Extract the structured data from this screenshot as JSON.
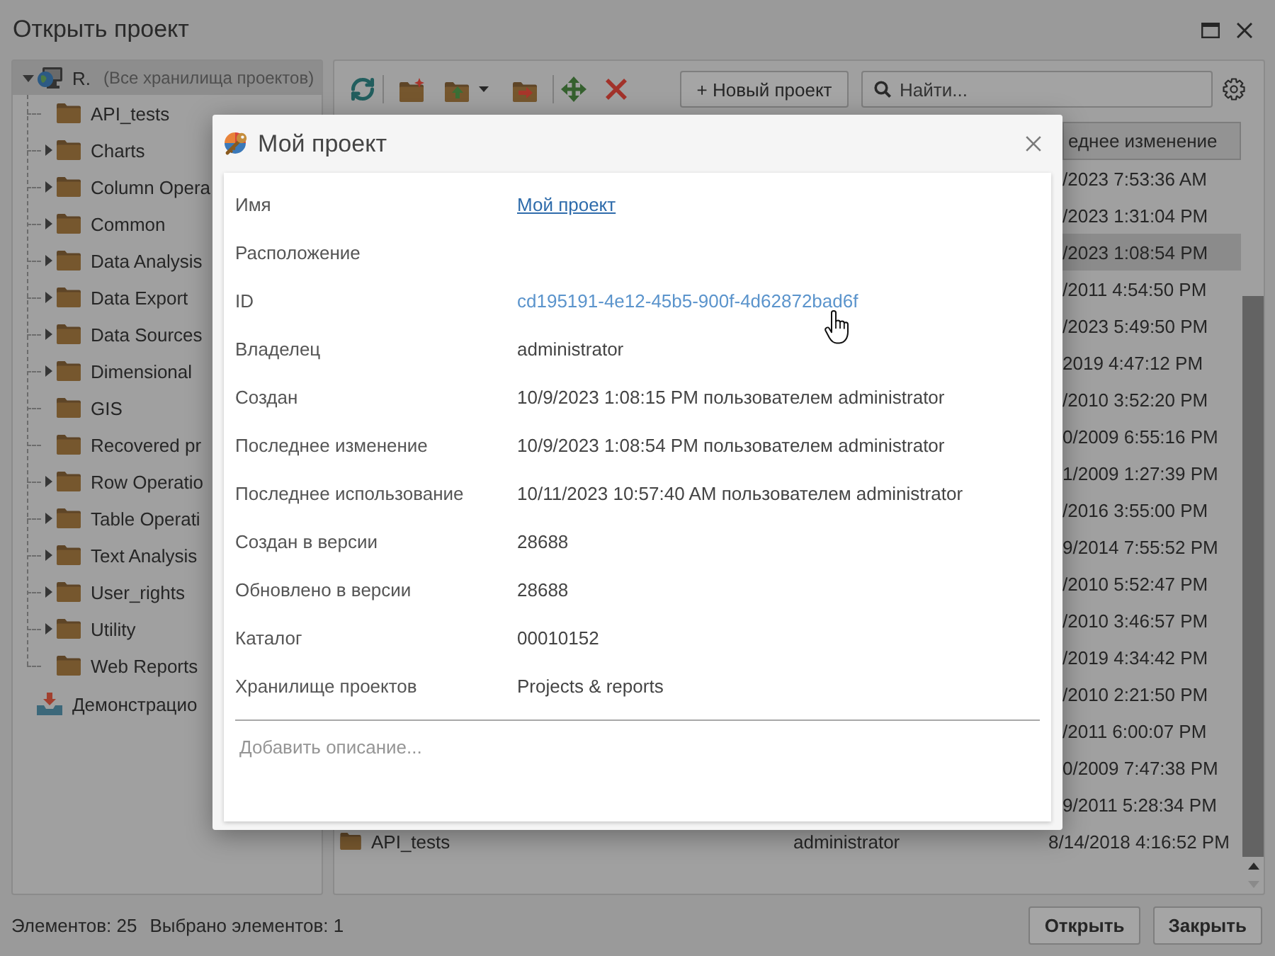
{
  "window": {
    "title": "Открыть проект"
  },
  "tree": [
    {
      "label": "R.",
      "note": "(Все хранилища проектов)",
      "kind": "repositories",
      "expanded": true,
      "selected": true,
      "children": [
        {
          "label": "API_tests",
          "kind": "folder",
          "selected": false
        },
        {
          "label": "Charts",
          "kind": "folder",
          "expanded": false,
          "selected": false
        },
        {
          "label": "Column Opera",
          "kind": "folder",
          "expanded": false,
          "selected": false
        },
        {
          "label": "Common",
          "kind": "folder",
          "expanded": false,
          "selected": false
        },
        {
          "label": "Data Analysis",
          "kind": "folder",
          "expanded": false,
          "selected": false
        },
        {
          "label": "Data Export",
          "kind": "folder",
          "expanded": false,
          "selected": false
        },
        {
          "label": "Data Sources",
          "kind": "folder",
          "expanded": false,
          "selected": false
        },
        {
          "label": "Dimensional",
          "kind": "folder",
          "expanded": false,
          "selected": false
        },
        {
          "label": "GIS",
          "kind": "folder",
          "selected": false
        },
        {
          "label": "Recovered pr",
          "kind": "folder",
          "selected": false
        },
        {
          "label": "Row Operatio",
          "kind": "folder",
          "expanded": false,
          "selected": false
        },
        {
          "label": "Table Operati",
          "kind": "folder",
          "expanded": false,
          "selected": false
        },
        {
          "label": "Text Analysis",
          "kind": "folder",
          "expanded": false,
          "selected": false
        },
        {
          "label": "User_rights",
          "kind": "folder",
          "expanded": false,
          "selected": false
        },
        {
          "label": "Utility",
          "kind": "folder",
          "expanded": false,
          "selected": false
        },
        {
          "label": "Web Reports",
          "kind": "folder",
          "selected": false
        }
      ]
    },
    {
      "label": "Демонстрацио",
      "kind": "demo",
      "selected": false
    }
  ],
  "toolbar": {
    "new_project_button": "+ Новый проект",
    "search": {
      "placeholder": "Найти..."
    }
  },
  "table": {
    "column_3_header": "еднее изменение",
    "rows": [
      {
        "column_3": "/2023 7:53:36 AM",
        "selected": false
      },
      {
        "column_3": "/2023 1:31:04 PM",
        "selected": false
      },
      {
        "column_3": "/2023 1:08:54 PM",
        "selected": true
      },
      {
        "column_3": "/2011 4:54:50 PM",
        "selected": false
      },
      {
        "column_3": "/2023 5:49:50 PM",
        "selected": false
      },
      {
        "column_3": "2019 4:47:12 PM",
        "selected": false
      },
      {
        "column_3": "/2010 3:52:20 PM",
        "selected": false
      },
      {
        "column_3": "0/2009 6:55:16 PM",
        "selected": false
      },
      {
        "column_3": "1/2009 1:27:39 PM",
        "selected": false
      },
      {
        "column_3": "/2016 3:55:00 PM",
        "selected": false
      },
      {
        "column_3": "9/2014 7:55:52 PM",
        "selected": false
      },
      {
        "column_3": "/2010 5:52:47 PM",
        "selected": false
      },
      {
        "column_3": "/2010 3:46:57 PM",
        "selected": false
      },
      {
        "column_3": "/2019 4:34:42 PM",
        "selected": false
      },
      {
        "column_3": "/2010 2:21:50 PM",
        "selected": false
      },
      {
        "column_3": "/2011 6:00:07 PM",
        "selected": false
      },
      {
        "column_3": "0/2009 7:47:38 PM",
        "selected": false
      },
      {
        "column_3": "9/2011 5:28:34 PM",
        "selected": false
      },
      {
        "column_1": "API_tests",
        "column_2": "administrator",
        "column_3": "8/14/2018 4:16:52 PM",
        "selected": false
      }
    ]
  },
  "status_bar": {
    "items_count": "Элементов: 25",
    "selected_count": "Выбрано элементов: 1"
  },
  "buttons": [
    "Открыть",
    "Закрыть"
  ],
  "dialog": {
    "title": "Мой проект",
    "properties": [
      {
        "label": "Имя",
        "value": "Мой проект",
        "kind": "link",
        "hovered": false
      },
      {
        "label": "Расположение",
        "hovered": false
      },
      {
        "label": "ID",
        "value": "cd195191-4e12-45b5-900f-4d62872bad6f",
        "kind": "id",
        "hovered": true
      },
      {
        "label": "Владелец",
        "value": "administrator",
        "kind": "text",
        "hovered": false
      },
      {
        "label": "Создан",
        "value": "10/9/2023 1:08:15 PM пользователем administrator",
        "kind": "text",
        "hovered": false
      },
      {
        "label": "Последнее изменение",
        "value": "10/9/2023 1:08:54 PM пользователем administrator",
        "kind": "text",
        "hovered": false
      },
      {
        "label": "Последнее использование",
        "value": "10/11/2023 10:57:40 AM пользователем administrator",
        "kind": "text",
        "hovered": false
      },
      {
        "label": "Создан в версии",
        "value": "28688",
        "kind": "text",
        "hovered": false
      },
      {
        "label": "Обновлено в версии",
        "value": "28688",
        "kind": "text",
        "hovered": false
      },
      {
        "label": "Каталог",
        "value": "00010152",
        "kind": "text",
        "hovered": false
      },
      {
        "label": "Хранилище проектов",
        "value": "Projects & reports",
        "kind": "text",
        "hovered": false
      }
    ],
    "description": {
      "placeholder": "Добавить описание..."
    }
  }
}
